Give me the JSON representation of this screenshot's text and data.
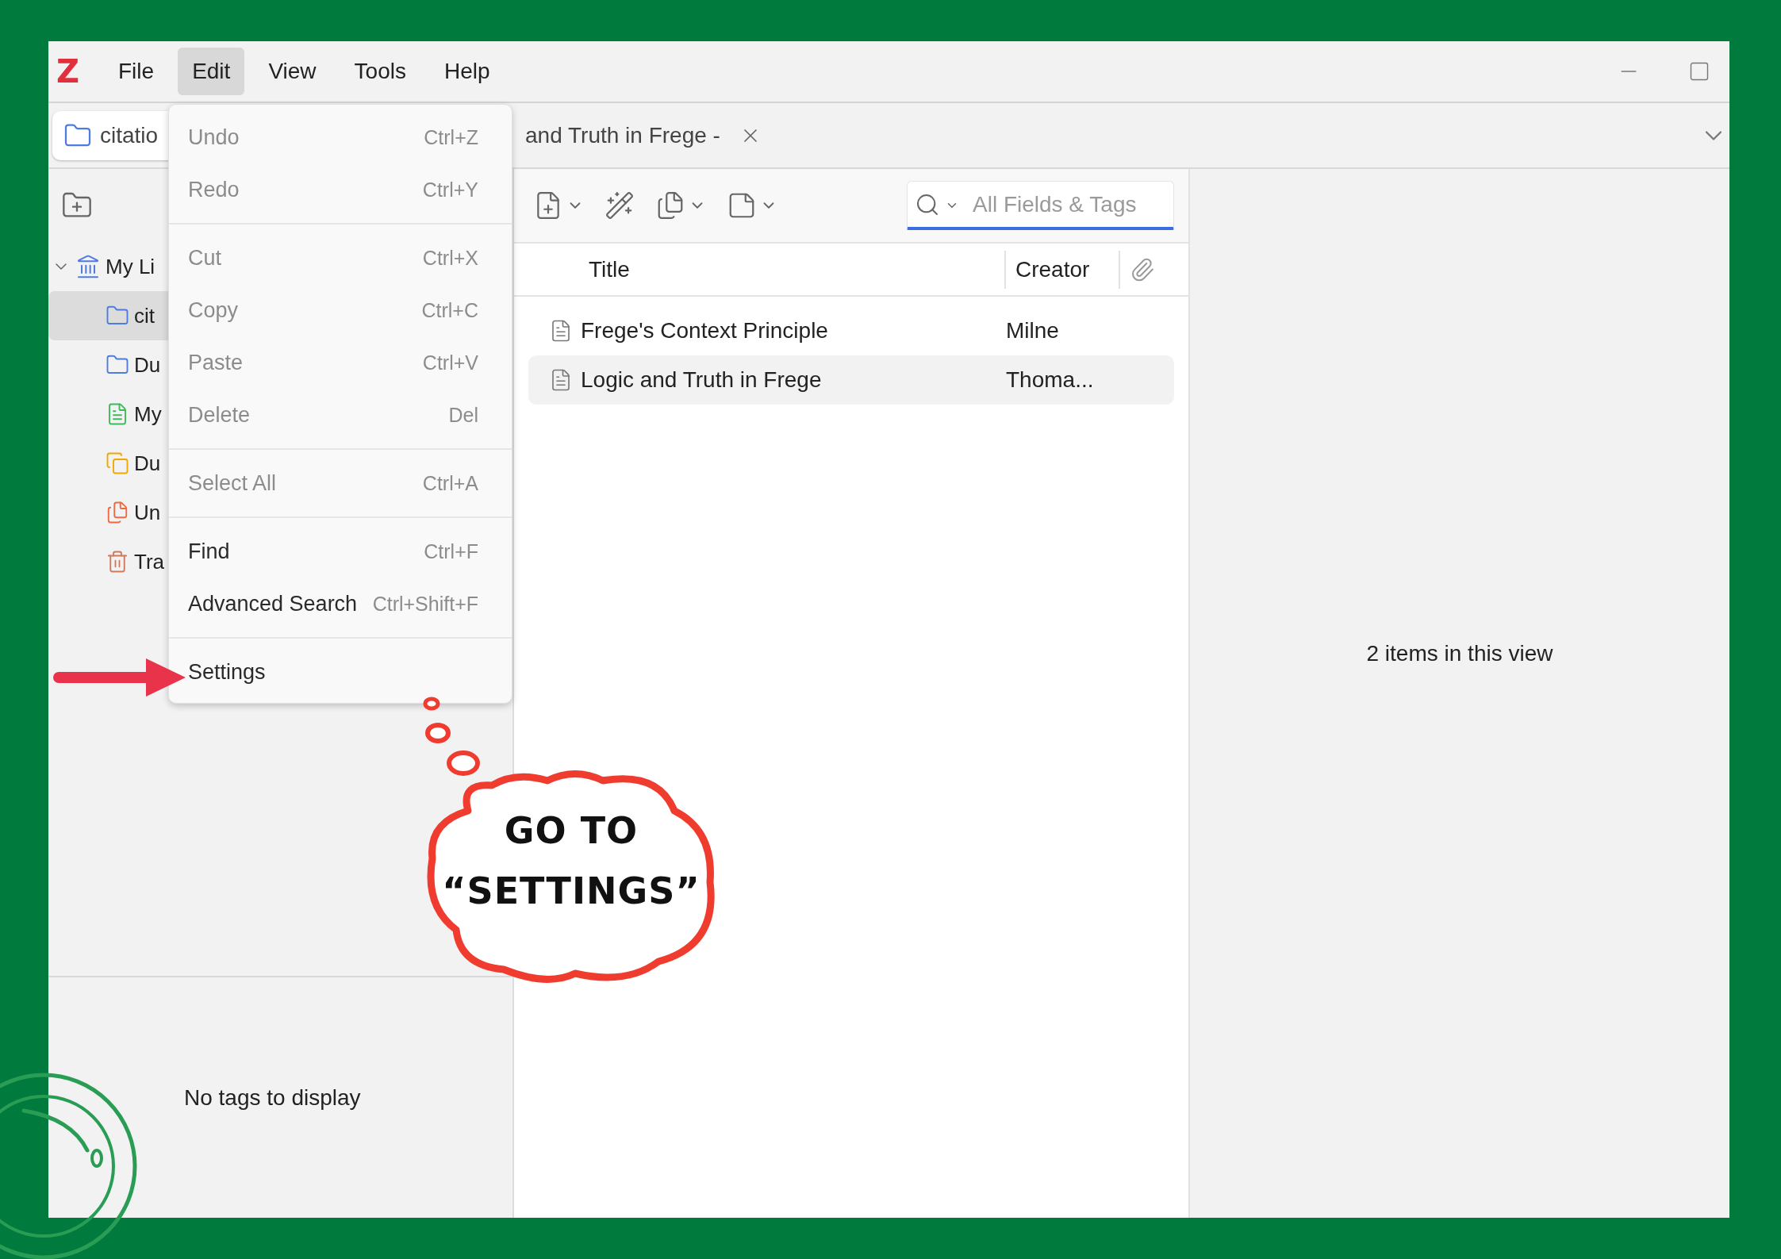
{
  "window": {
    "logo": "Z"
  },
  "menubar": [
    {
      "label": "File",
      "selected": false
    },
    {
      "label": "Edit",
      "selected": true
    },
    {
      "label": "View",
      "selected": false
    },
    {
      "label": "Tools",
      "selected": false
    },
    {
      "label": "Help",
      "selected": false
    }
  ],
  "tabs": [
    {
      "label": "citatio",
      "kind": "library",
      "selected": true
    },
    {
      "label": "and Truth in Frege -",
      "kind": "reader",
      "selected": false
    }
  ],
  "collections": {
    "label": "My Li",
    "expanded": true,
    "children": [
      {
        "label": "cit",
        "kind": "folder",
        "selected": true
      },
      {
        "label": "Du",
        "kind": "folder",
        "selected": false
      },
      {
        "label": "My",
        "kind": "notes",
        "selected": false
      },
      {
        "label": "Du",
        "kind": "duplicates",
        "selected": false
      },
      {
        "label": "Un",
        "kind": "unfiled",
        "selected": false
      },
      {
        "label": "Tra",
        "kind": "trash",
        "selected": false
      }
    ]
  },
  "tag_selector": {
    "message": "No tags to display"
  },
  "search": {
    "placeholder": "All Fields & Tags"
  },
  "items_table": {
    "columns": [
      "Title",
      "Creator"
    ],
    "rows": [
      {
        "title": "Frege's Context Principle",
        "creator": "Milne",
        "selected": false
      },
      {
        "title": "Logic and Truth in Frege",
        "creator": "Thoma...",
        "selected": true
      }
    ]
  },
  "item_pane": {
    "message": "2 items in this view"
  },
  "edit_menu": {
    "items": [
      {
        "kind": "item",
        "label": "Undo",
        "shortcut": "Ctrl+Z",
        "disabled": true
      },
      {
        "kind": "item",
        "label": "Redo",
        "shortcut": "Ctrl+Y",
        "disabled": true
      },
      {
        "kind": "separator"
      },
      {
        "kind": "item",
        "label": "Cut",
        "shortcut": "Ctrl+X",
        "disabled": true
      },
      {
        "kind": "item",
        "label": "Copy",
        "shortcut": "Ctrl+C",
        "disabled": true
      },
      {
        "kind": "item",
        "label": "Paste",
        "shortcut": "Ctrl+V",
        "disabled": true
      },
      {
        "kind": "item",
        "label": "Delete",
        "shortcut": "Del",
        "disabled": true
      },
      {
        "kind": "separator"
      },
      {
        "kind": "item",
        "label": "Select All",
        "shortcut": "Ctrl+A",
        "disabled": true
      },
      {
        "kind": "separator"
      },
      {
        "kind": "item",
        "label": "Find",
        "shortcut": "Ctrl+F",
        "disabled": false
      },
      {
        "kind": "item",
        "label": "Advanced Search",
        "shortcut": "Ctrl+Shift+F",
        "disabled": false
      },
      {
        "kind": "separator"
      },
      {
        "kind": "item",
        "label": "Settings",
        "disabled": false
      }
    ]
  },
  "annotation": {
    "callout_lines": [
      "GO TO",
      "“SETTINGS”"
    ]
  }
}
